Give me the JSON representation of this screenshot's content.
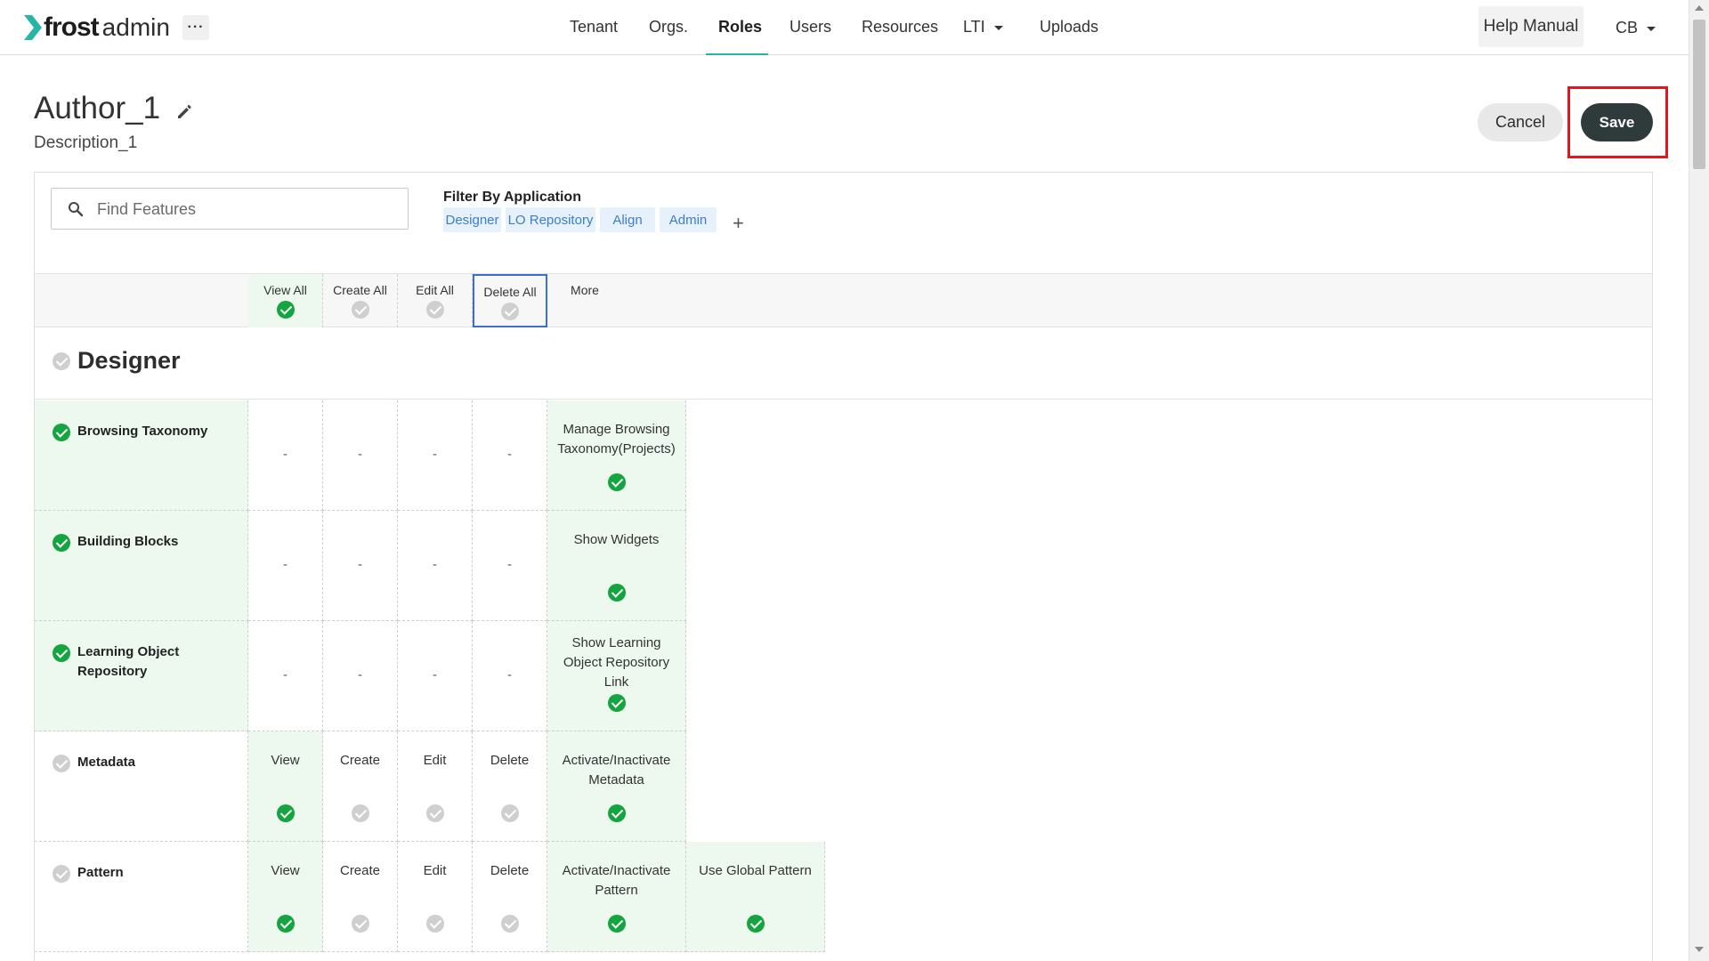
{
  "app": {
    "logo_bold": "frost",
    "logo_light": "admin",
    "more_label": "···"
  },
  "nav": {
    "items": [
      {
        "label": "Tenant"
      },
      {
        "label": "Orgs."
      },
      {
        "label": "Roles",
        "active": true
      },
      {
        "label": "Users"
      },
      {
        "label": "Resources"
      },
      {
        "label": "LTI"
      },
      {
        "label": "Uploads"
      }
    ],
    "help": "Help Manual",
    "user": "CB"
  },
  "role": {
    "title": "Author_1",
    "description": "Description_1"
  },
  "actions": {
    "cancel": "Cancel",
    "save": "Save"
  },
  "search": {
    "placeholder": "Find Features",
    "value": ""
  },
  "filter": {
    "label": "Filter By Application",
    "chips": [
      "Designer",
      "LO Repository",
      "Align",
      "Admin"
    ],
    "add": "+"
  },
  "grid_header": {
    "columns": [
      {
        "label": "View All",
        "checked": true
      },
      {
        "label": "Create All",
        "checked": false
      },
      {
        "label": "Edit All",
        "checked": false
      },
      {
        "label": "Delete All",
        "checked": false
      },
      {
        "label": "More"
      }
    ]
  },
  "section": {
    "title": "Designer",
    "checked": false
  },
  "rows": [
    {
      "label": "Browsing Taxonomy",
      "checked": true,
      "cells": [
        "-",
        "-",
        "-",
        "-"
      ],
      "extras": [
        {
          "label": "Manage Browsing Taxonomy(Projects)",
          "checked": true
        }
      ]
    },
    {
      "label": "Building Blocks",
      "checked": true,
      "cells": [
        "-",
        "-",
        "-",
        "-"
      ],
      "extras": [
        {
          "label": "Show Widgets",
          "checked": true
        }
      ]
    },
    {
      "label": "Learning Object Repository",
      "checked": true,
      "cells": [
        "-",
        "-",
        "-",
        "-"
      ],
      "extras": [
        {
          "label": "Show Learning Object Repository Link",
          "checked": true
        }
      ]
    },
    {
      "label": "Metadata",
      "checked": false,
      "cells": [
        {
          "label": "View",
          "checked": true
        },
        {
          "label": "Create",
          "checked": false
        },
        {
          "label": "Edit",
          "checked": false
        },
        {
          "label": "Delete",
          "checked": false
        }
      ],
      "extras": [
        {
          "label": "Activate/Inactivate Metadata",
          "checked": true
        }
      ]
    },
    {
      "label": "Pattern",
      "checked": false,
      "cells": [
        {
          "label": "View",
          "checked": true
        },
        {
          "label": "Create",
          "checked": false
        },
        {
          "label": "Edit",
          "checked": false
        },
        {
          "label": "Delete",
          "checked": false
        }
      ],
      "extras": [
        {
          "label": "Activate/Inactivate Pattern",
          "checked": true
        },
        {
          "label": "Use Global Pattern",
          "checked": true
        }
      ]
    }
  ],
  "colors": {
    "accent_teal": "#26b5a8",
    "check_green": "#15a43f",
    "check_grey": "#cfcfcf",
    "cell_green_bg": "#edf9ee",
    "chip_bg": "#e6f1fb",
    "chip_text": "#3d7dc9",
    "save_bg": "#2f3a3a",
    "highlight_red": "#e8131b"
  }
}
